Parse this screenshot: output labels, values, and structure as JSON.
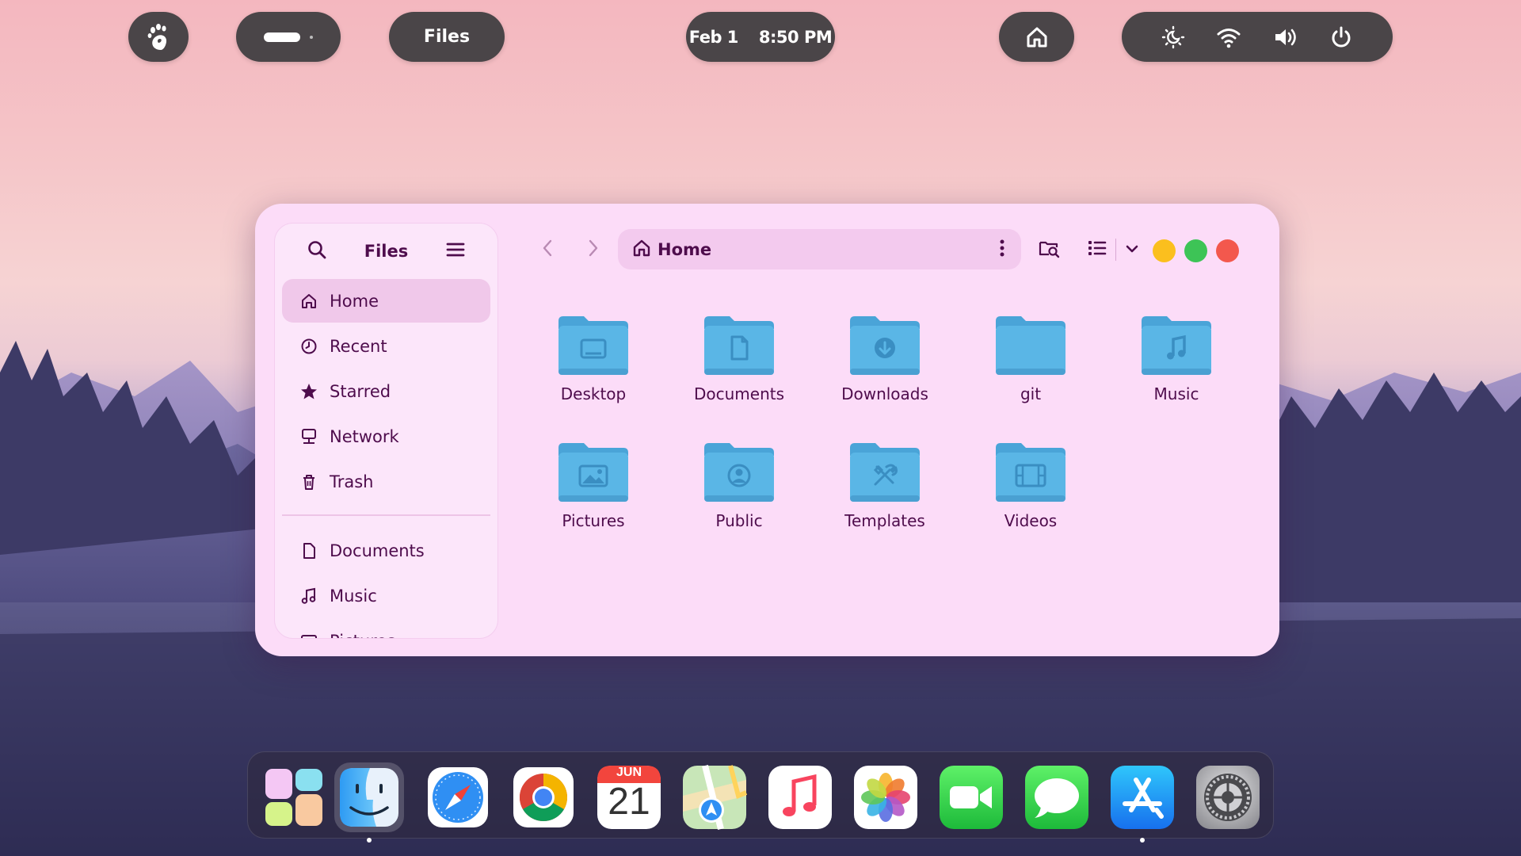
{
  "topbar": {
    "activities_icon": "gnome-foot-icon",
    "active_app": "Files",
    "date": "Feb 1",
    "time": "8:50 PM",
    "status_icons": [
      "night-light-icon",
      "wifi-icon",
      "volume-icon",
      "power-icon"
    ]
  },
  "window": {
    "sidebar": {
      "title": "Files",
      "items": [
        {
          "label": "Home",
          "icon": "home-icon"
        },
        {
          "label": "Recent",
          "icon": "clock-icon"
        },
        {
          "label": "Starred",
          "icon": "star-icon"
        },
        {
          "label": "Network",
          "icon": "network-icon"
        },
        {
          "label": "Trash",
          "icon": "trash-icon"
        }
      ],
      "bookmarks": [
        {
          "label": "Documents",
          "icon": "document-icon"
        },
        {
          "label": "Music",
          "icon": "music-icon"
        },
        {
          "label": "Pictures",
          "icon": "picture-icon"
        }
      ]
    },
    "path": {
      "label": "Home"
    },
    "folders": [
      {
        "label": "Desktop",
        "icon": "desktop-icon"
      },
      {
        "label": "Documents",
        "icon": "document-icon"
      },
      {
        "label": "Downloads",
        "icon": "download-icon"
      },
      {
        "label": "git",
        "icon": "folder-icon"
      },
      {
        "label": "Music",
        "icon": "music-icon"
      },
      {
        "label": "Pictures",
        "icon": "picture-icon"
      },
      {
        "label": "Public",
        "icon": "user-icon"
      },
      {
        "label": "Templates",
        "icon": "tools-icon"
      },
      {
        "label": "Videos",
        "icon": "film-icon"
      }
    ],
    "traffic_colors": {
      "minimize": "#fbbf1e",
      "maximize": "#3dc456",
      "close": "#f3584d"
    }
  },
  "dock": {
    "apps": [
      "launchpad",
      "finder",
      "safari",
      "chrome",
      "calendar",
      "maps",
      "music",
      "photos",
      "facetime",
      "messages",
      "app-store",
      "system-settings"
    ],
    "calendar": {
      "month": "JUN",
      "day": "21"
    }
  },
  "colors": {
    "accent_text": "#4e0c4c",
    "window_bg": "#fcdcf8",
    "folder_blue": "#5ab6e6"
  }
}
